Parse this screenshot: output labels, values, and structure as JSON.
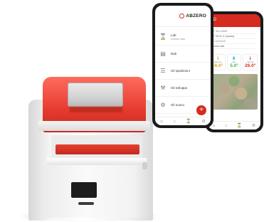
{
  "phone_left": {
    "logo": "ABZERO",
    "menu": [
      {
        "icon": "hourglass-icon",
        "glyph": "⌛",
        "label": "Lab",
        "sub": "Nessun dato"
      },
      {
        "icon": "document-icon",
        "glyph": "▤",
        "label": "Dati",
        "sub": ""
      },
      {
        "icon": "list-icon",
        "glyph": "☰",
        "label": "Gli spedizioni",
        "sub": ""
      },
      {
        "icon": "wrench-icon",
        "glyph": "⚒",
        "label": "Gli sviluppo",
        "sub": ""
      },
      {
        "icon": "settings-icon",
        "glyph": "⚙",
        "label": "Gli nuovo",
        "sub": ""
      }
    ],
    "fab_label": "+",
    "nav": [
      "⌂",
      "⌂",
      "⌛",
      "⚙"
    ]
  },
  "phone_right": {
    "header_title": "ID",
    "info_lines": [
      "N° 10-1-2022",
      "N° 5678-11 (aaaaa)",
      "C: 0,0,0,0,0",
      "Carico dati"
    ],
    "tiles": [
      {
        "icon": "🌡",
        "label": "Esterna",
        "value": "-6.0°",
        "color": "#e0a020"
      },
      {
        "icon": "💧",
        "label": "Min",
        "value": "5.0°",
        "color": "#4caf50"
      },
      {
        "icon": "🌡",
        "label": "Interna",
        "value": "26.0°",
        "color": "#d62b1f"
      }
    ],
    "nav": [
      "⌂",
      "⌂",
      "⌛",
      "⚙"
    ]
  },
  "colors": {
    "accent": "#d62b1f",
    "device_red": "#e53b2f"
  }
}
